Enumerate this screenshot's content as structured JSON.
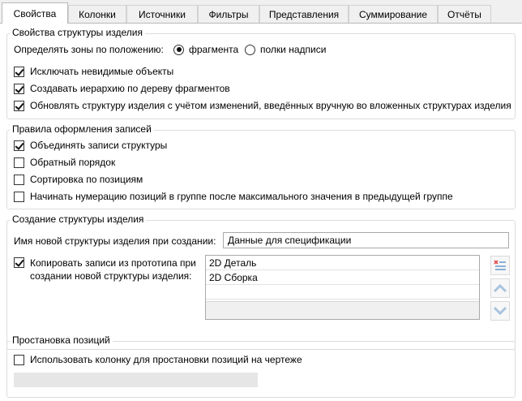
{
  "tabs": [
    {
      "label": "Свойства",
      "active": true
    },
    {
      "label": "Колонки"
    },
    {
      "label": "Источники"
    },
    {
      "label": "Фильтры"
    },
    {
      "label": "Представления"
    },
    {
      "label": "Суммирование"
    },
    {
      "label": "Отчёты"
    }
  ],
  "group1": {
    "title": "Свойства структуры изделия",
    "zones_label": "Определять зоны по положению:",
    "radio_fragment": {
      "label": "фрагмента",
      "checked": true
    },
    "radio_title_fields": {
      "label": "полки надписи",
      "checked": false
    },
    "cb_exclude_invisible": {
      "label": "Исключать невидимые объекты",
      "checked": true
    },
    "cb_create_hierarchy": {
      "label": "Создавать иерархию по дереву фрагментов",
      "checked": true
    },
    "cb_update_structure": {
      "label": "Обновлять структуру изделия с учётом изменений, введённых вручную во вложенных структурах изделия",
      "checked": true
    }
  },
  "group2": {
    "title": "Правила оформления записей",
    "cb_merge": {
      "label": "Объединять записи структуры",
      "checked": true
    },
    "cb_reverse": {
      "label": "Обратный порядок",
      "checked": false
    },
    "cb_sort": {
      "label": "Сортировка по позициям",
      "checked": false
    },
    "cb_numbering": {
      "label": "Начинать нумерацию позиций в группе после максимального значения в предыдущей группе",
      "checked": false
    }
  },
  "group3": {
    "title": "Создание структуры изделия",
    "name_label": "Имя новой структуры изделия при создании:",
    "name_value": "Данные для спецификации",
    "cb_copy": {
      "label": "Копировать записи из прототипа при создании новой структуры изделия:",
      "checked": true
    },
    "prototypes": [
      "2D Деталь",
      "2D Сборка"
    ],
    "icons": {
      "delete": "delete-list-icon",
      "up": "arrow-up-icon",
      "down": "arrow-down-icon"
    }
  },
  "group4": {
    "title": "Простановка позиций",
    "cb_use_column": {
      "label": "Использовать колонку для простановки позиций на чертеже",
      "checked": false
    }
  }
}
